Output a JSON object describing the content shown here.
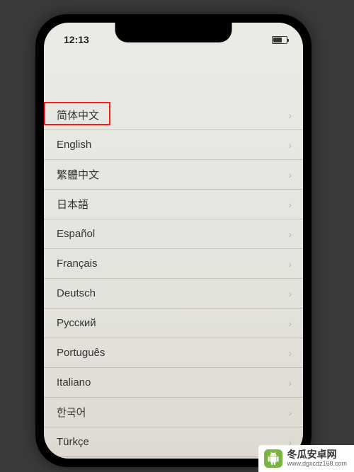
{
  "statusBar": {
    "time": "12:13"
  },
  "languages": [
    {
      "label": "简体中文"
    },
    {
      "label": "English"
    },
    {
      "label": "繁體中文"
    },
    {
      "label": "日本語"
    },
    {
      "label": "Español"
    },
    {
      "label": "Français"
    },
    {
      "label": "Deutsch"
    },
    {
      "label": "Русский"
    },
    {
      "label": "Português"
    },
    {
      "label": "Italiano"
    },
    {
      "label": "한국어"
    },
    {
      "label": "Türkçe"
    }
  ],
  "watermark": {
    "title": "冬瓜安卓网",
    "url": "www.dgxcdz168.com"
  }
}
